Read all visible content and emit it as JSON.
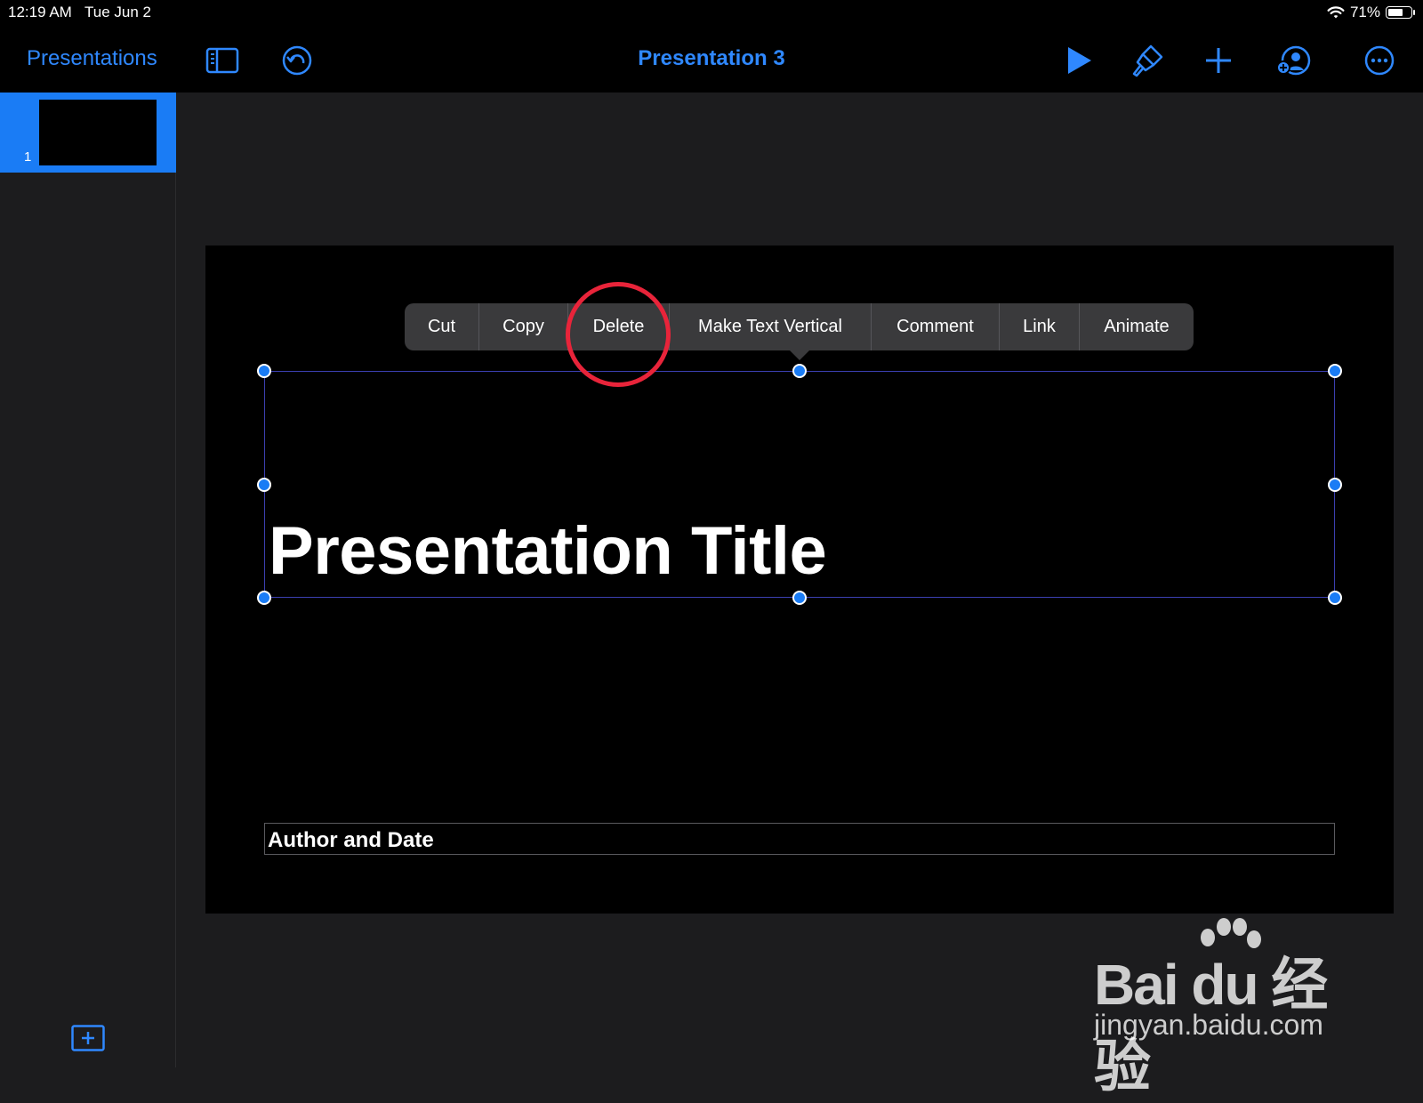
{
  "status_bar": {
    "time": "12:19 AM",
    "date": "Tue Jun 2",
    "battery": "71%",
    "battery_level": 0.71
  },
  "toolbar": {
    "back_label": "Presentations",
    "title": "Presentation 3",
    "icons": [
      "sidebar-toggle-icon",
      "undo-icon",
      "play-icon",
      "format-brush-icon",
      "plus-icon",
      "collaborate-icon",
      "more-icon"
    ]
  },
  "sidebar": {
    "slides": [
      {
        "number": "1",
        "selected": true
      }
    ]
  },
  "context_menu": {
    "items": [
      "Cut",
      "Copy",
      "Delete",
      "Make Text Vertical",
      "Comment",
      "Link",
      "Animate"
    ],
    "highlighted": "Delete"
  },
  "slide": {
    "title": "Presentation Title",
    "subtitle": "Author and Date"
  },
  "watermark": {
    "logo": "Bai du 经验",
    "site": "jingyan.baidu.com"
  },
  "colors": {
    "accent": "#1a7cf5",
    "link": "#2f88ff",
    "highlight": "#e8243a"
  }
}
